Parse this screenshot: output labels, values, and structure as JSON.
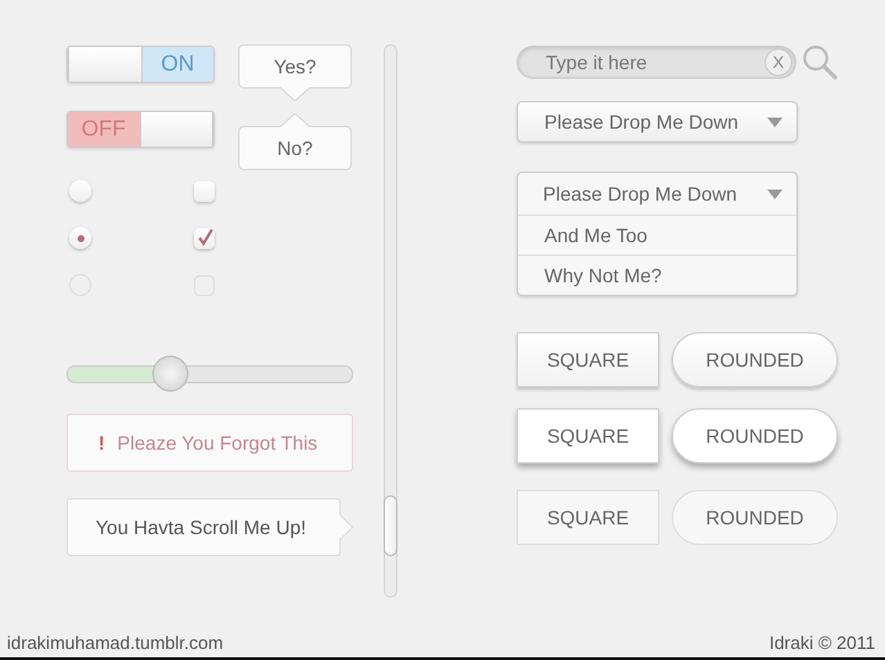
{
  "toggles": [
    {
      "label": "ON",
      "on": true
    },
    {
      "label": "OFF",
      "on": false
    }
  ],
  "bubbles": [
    {
      "text": "Yes?",
      "kind": "down"
    },
    {
      "text": "No?",
      "kind": "up"
    }
  ],
  "choices": [
    {
      "kind": "radio",
      "checked": false,
      "disabled": false
    },
    {
      "kind": "checkbox",
      "checked": false,
      "disabled": false
    },
    {
      "kind": "radio",
      "checked": true,
      "disabled": false
    },
    {
      "kind": "checkbox",
      "checked": true,
      "disabled": false
    },
    {
      "kind": "radio",
      "checked": false,
      "disabled": true
    },
    {
      "kind": "checkbox",
      "checked": false,
      "disabled": true
    }
  ],
  "slider": {
    "level": 0.36
  },
  "alert": {
    "icon": "!",
    "text": "Pleaze You Forgot This"
  },
  "tooltip": {
    "text": "You Havta Scroll Me Up!"
  },
  "search": {
    "placeholder": "Type it here",
    "clear": "X"
  },
  "dropdowns": [
    {
      "label": "Please Drop Me Down",
      "expanded": false
    },
    {
      "label": "Please Drop Me Down",
      "expanded": true,
      "options": [
        "And Me Too",
        "Why Not Me?"
      ]
    }
  ],
  "button_rows": [
    {
      "kind": "raised",
      "square": "SQUARE",
      "rounded": "ROUNDED"
    },
    {
      "kind": "elevated",
      "square": "SQUARE",
      "rounded": "ROUNDED"
    },
    {
      "kind": "flat",
      "square": "SQUARE",
      "rounded": "ROUNDED"
    }
  ],
  "footer": {
    "site": "idrakimuhamad.tumblr.com",
    "credit": "Idraki © 2011"
  }
}
